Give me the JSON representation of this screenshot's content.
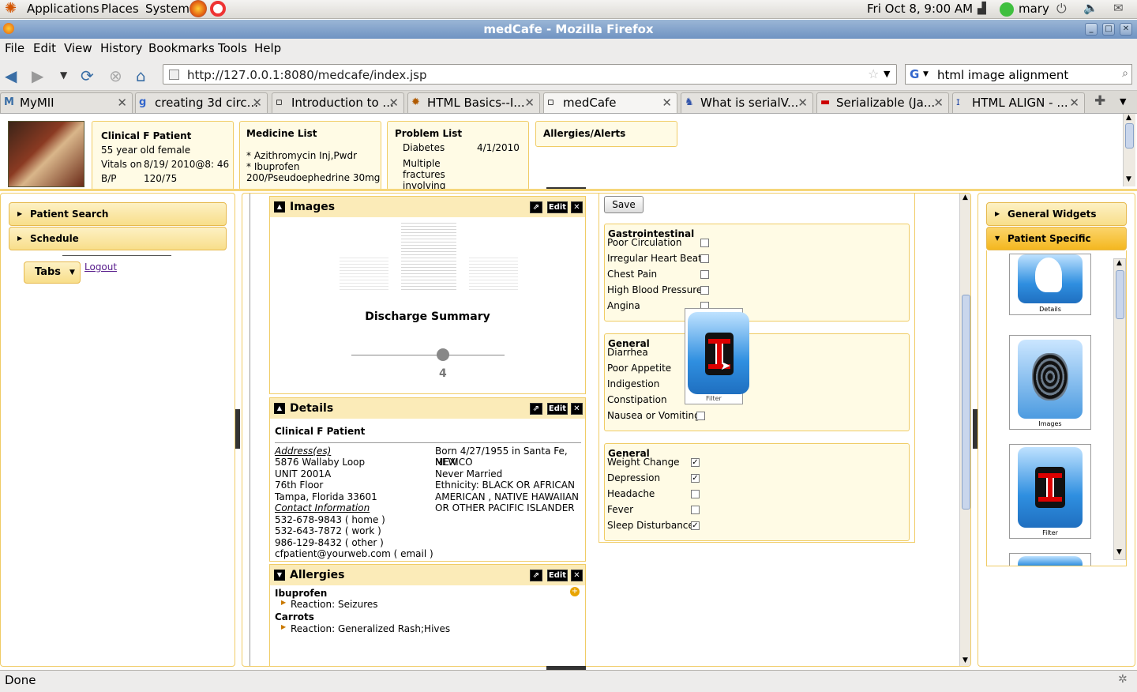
{
  "gnome_panel": {
    "applications": "Applications",
    "places": "Places",
    "system": "System",
    "datetime": "Fri Oct  8,  9:00 AM",
    "user": "mary"
  },
  "window": {
    "title": "medCafe - Mozilla Firefox"
  },
  "menu": [
    "File",
    "Edit",
    "View",
    "History",
    "Bookmarks",
    "Tools",
    "Help"
  ],
  "nav": {
    "url": "http://127.0.0.1:8080/medcafe/index.jsp",
    "search": "html image alignment"
  },
  "tabs": [
    {
      "label": "MyMII"
    },
    {
      "label": "creating 3d circ..."
    },
    {
      "label": "Introduction to ..."
    },
    {
      "label": "HTML Basics--I..."
    },
    {
      "label": "medCafe"
    },
    {
      "label": "What is serialV..."
    },
    {
      "label": "Serializable (Ja..."
    },
    {
      "label": "HTML ALIGN - ..."
    }
  ],
  "patient": {
    "name": "Clinical F Patient",
    "age_sex": "55 year old female",
    "vitals_label": "Vitals on",
    "vitals_value": "8/19/ 2010@8: 46",
    "bp_label": "B/P",
    "bp_value": "120/75"
  },
  "medicine": {
    "title": "Medicine List",
    "items": [
      "* Azithromycin Inj,Pwdr",
      "* Ibuprofen",
      "200/Pseudoephedrine 30mg"
    ]
  },
  "problems": {
    "title": "Problem List",
    "diabetes": "Diabetes",
    "diabetes_date": "4/1/2010",
    "multiple": "Multiple",
    "fractures": "fractures",
    "involving": "involving"
  },
  "alerts": {
    "title": "Allergies/Alerts"
  },
  "left_nav": {
    "patient_search": "Patient Search",
    "schedule": "Schedule",
    "tabs": "Tabs",
    "logout": "Logout"
  },
  "images_portlet": {
    "title": "Images",
    "edit": "Edit",
    "caption": "Discharge Summary",
    "slider_value": "4"
  },
  "details_portlet": {
    "title": "Details",
    "edit": "Edit",
    "name": "Clinical F Patient",
    "address_label": "Address(es)",
    "address": [
      "5876 Wallaby Loop",
      "UNIT 2001A",
      "76th Floor",
      "Tampa, Florida 33601"
    ],
    "contact_label": "Contact Information",
    "contact": [
      "532-678-9843 ( home )",
      "532-643-7872 ( work )",
      "986-129-8432 ( other )",
      "cfpatient@yourweb.com ( email )"
    ],
    "right": [
      "Born 4/27/1955 in Santa Fe, NEW",
      "MEXICO",
      "Never Married",
      "Ethnicity: BLACK OR AFRICAN",
      "AMERICAN , NATIVE HAWAIIAN",
      "OR OTHER PACIFIC ISLANDER"
    ]
  },
  "allergies_portlet": {
    "title": "Allergies",
    "edit": "Edit",
    "a1": "Ibuprofen",
    "r1": "Reaction: Seizures",
    "a2": "Carrots",
    "r2": "Reaction: Generalized Rash;Hives"
  },
  "symptoms": {
    "save": "Save",
    "g1_title": "Gastrointestinal",
    "g1": [
      {
        "label": "Poor Circulation",
        "checked": false
      },
      {
        "label": "Irregular Heart Beat",
        "checked": false
      },
      {
        "label": "Chest Pain",
        "checked": false
      },
      {
        "label": "High Blood Pressure",
        "checked": false
      },
      {
        "label": "Angina",
        "checked": false
      }
    ],
    "g2_title": "General",
    "g2": [
      {
        "label": "Diarrhea",
        "checked": false
      },
      {
        "label": "Poor Appetite",
        "checked": false
      },
      {
        "label": "Indigestion",
        "checked": false
      },
      {
        "label": "Constipation",
        "checked": false
      },
      {
        "label": "Nausea or Vomiting",
        "checked": false
      }
    ],
    "g3_title": "General",
    "g3": [
      {
        "label": "Weight Change",
        "checked": true
      },
      {
        "label": "Depression",
        "checked": true
      },
      {
        "label": "Headache",
        "checked": false
      },
      {
        "label": "Fever",
        "checked": false
      },
      {
        "label": "Sleep Disturbance",
        "checked": true
      }
    ],
    "drag_label": "Filter"
  },
  "right_panel": {
    "general_widgets": "General Widgets",
    "patient_specific": "Patient Specific",
    "w1": "Details",
    "w2": "Images",
    "w3": "Filter"
  },
  "status": {
    "text": "Done"
  }
}
